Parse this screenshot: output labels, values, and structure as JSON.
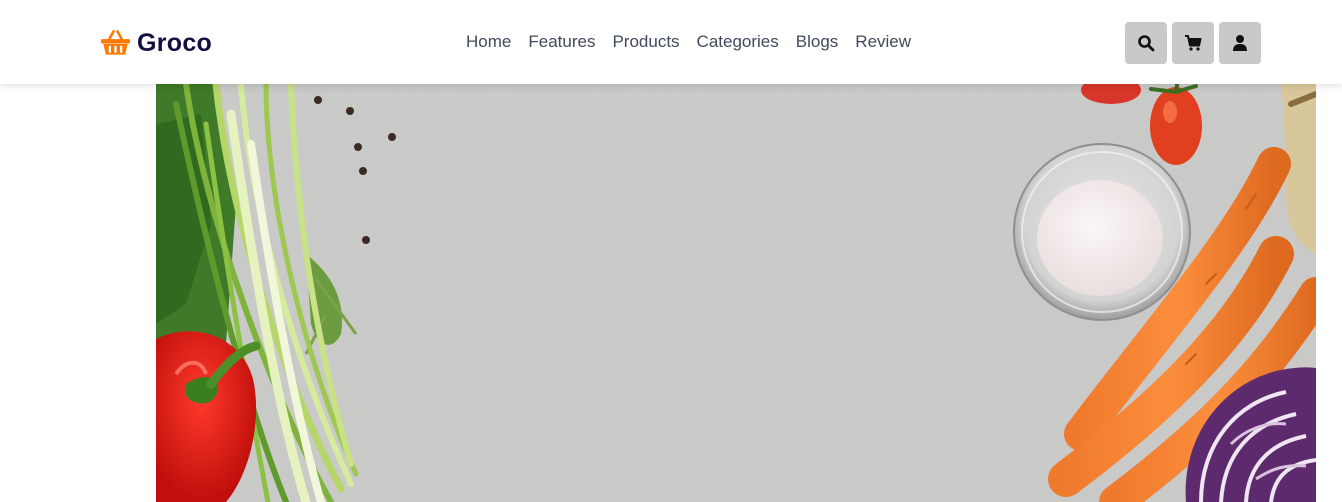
{
  "brand": {
    "name": "Groco",
    "icon": "basket-icon",
    "accent": "#ff7800",
    "text_color": "#130f40"
  },
  "nav": {
    "items": [
      {
        "label": "Home"
      },
      {
        "label": "Features"
      },
      {
        "label": "Products"
      },
      {
        "label": "Categories"
      },
      {
        "label": "Blogs"
      },
      {
        "label": "Review"
      }
    ]
  },
  "header_icons": [
    {
      "icon": "search-icon"
    },
    {
      "icon": "cart-icon"
    },
    {
      "icon": "user-icon"
    }
  ],
  "hero": {
    "image": "vegetables-on-stone-background"
  }
}
